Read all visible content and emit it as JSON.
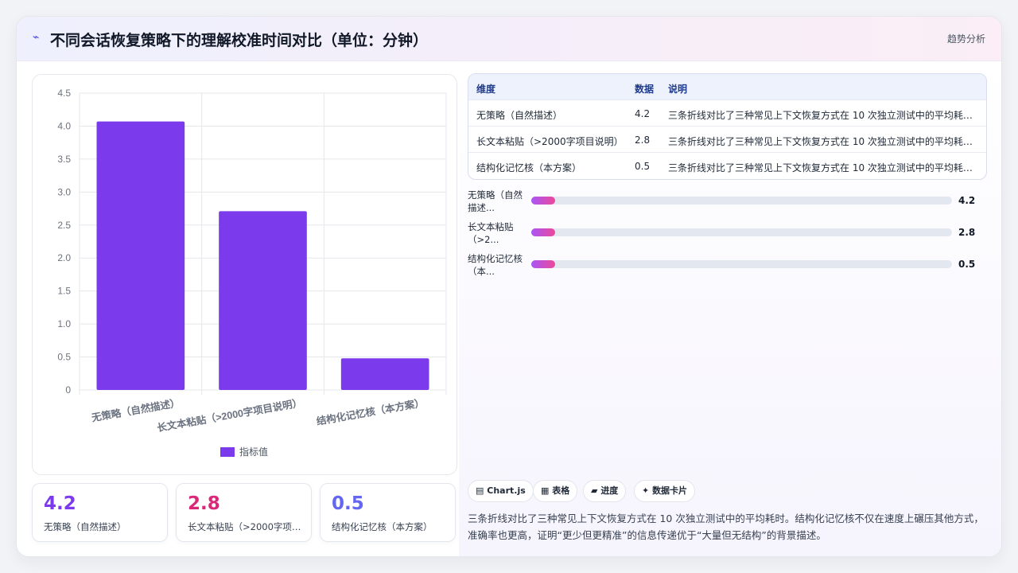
{
  "header": {
    "logo_icon": "trend-icon",
    "logo_glyph": "⌁",
    "title": "不同会话恢复策略下的理解校准时间对比（单位：分钟）",
    "action": "趋势分析"
  },
  "chart_data": {
    "type": "bar",
    "categories": [
      "无策略（自然描述）",
      "长文本粘贴（>2000字项目说明）",
      "结构化记忆核（本方案）"
    ],
    "series": [
      {
        "name": "指标值",
        "values": [
          4.07,
          2.71,
          0.48
        ],
        "color": "#7c3aed"
      }
    ],
    "yticks": [
      "0",
      "0.5",
      "1.0",
      "1.5",
      "2.0",
      "2.5",
      "3.0",
      "3.5",
      "4.0",
      "4.5"
    ],
    "ylim": [
      0,
      4.5
    ],
    "grid": true,
    "legend": "bottom"
  },
  "kpis": [
    {
      "value": "4.2",
      "label": "无策略（自然描述）",
      "color": "#7c3aed"
    },
    {
      "value": "2.8",
      "label": "长文本粘贴（>2000字项目说明）",
      "color": "#db2777"
    },
    {
      "value": "0.5",
      "label": "结构化记忆核（本方案）",
      "color": "#6366f1"
    }
  ],
  "table": {
    "headers": [
      "维度",
      "数据",
      "说明"
    ],
    "rows": [
      {
        "dim": "无策略（自然描述）",
        "value": "4.2",
        "note": "三条折线对比了三种常见上下文恢复方式在 10 次独立测试中的平均耗时。结构化记忆核不仅在速度上碾压其他方式，准确率也更高，证明“更少但更精准”的信息传递优于“大量但无结构”的背景描述。"
      },
      {
        "dim": "长文本粘贴（>2000字项目说明）",
        "value": "2.8",
        "note": "三条折线对比了三种常见上下文恢复方式在 10 次独立测试中的平均耗时。结构化记忆核不仅在速度上碾压其他方式，准确率也更高，证明“更少但更精准”的信息传递优于“大量但无结构”的背景描述。"
      },
      {
        "dim": "结构化记忆核（本方案）",
        "value": "0.5",
        "note": "三条折线对比了三种常见上下文恢复方式在 10 次独立测试中的平均耗时。结构化记忆核不仅在速度上碾压其他方式，准确率也更高，证明“更少但更精准”的信息传递优于“大量但无结构”的背景描述。"
      }
    ]
  },
  "progress": [
    {
      "label": "无策略（自然描述...",
      "value": "4.2",
      "fraction": 0.057
    },
    {
      "label": "长文本粘贴（>2...",
      "value": "2.8",
      "fraction": 0.057
    },
    {
      "label": "结构化记忆核（本...",
      "value": "0.5",
      "fraction": 0.057
    }
  ],
  "chips": [
    {
      "icon": "chart-icon",
      "glyph": "▤",
      "label": "Chart.js"
    },
    {
      "icon": "table-icon",
      "glyph": "▦",
      "label": "表格"
    },
    {
      "icon": "progress-icon",
      "glyph": "▰",
      "label": "进度"
    },
    {
      "icon": "sparkle-icon",
      "glyph": "✦",
      "label": "数据卡片"
    }
  ],
  "description": "三条折线对比了三种常见上下文恢复方式在 10 次独立测试中的平均耗时。结构化记忆核不仅在速度上碾压其他方式，准确率也更高，证明“更少但更精准”的信息传递优于“大量但无结构”的背景描述。"
}
